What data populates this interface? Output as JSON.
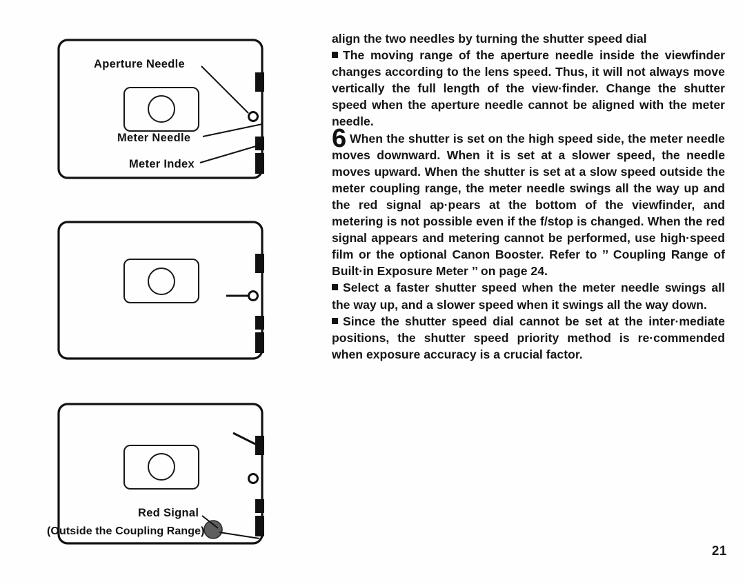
{
  "page": {
    "number": "21",
    "background_color": "#fefefe",
    "ink_color": "#111111"
  },
  "figures": [
    {
      "id": "viewfinder-needles-labeled",
      "labels": {
        "aperture_needle": "Aperture Needle",
        "meter_needle": "Meter Needle",
        "meter_index": "Meter Index"
      }
    },
    {
      "id": "viewfinder-needles-aligned",
      "labels": {}
    },
    {
      "id": "viewfinder-red-signal",
      "labels": {
        "red_signal": "Red Signal",
        "outside_range": "(Outside the Coupling Range)"
      }
    }
  ],
  "body": {
    "lead_line": "align the two needles by turning the shutter speed dial",
    "bullet_1": "The moving range of the aperture needle inside the viewfinder changes according to the lens speed.  Thus, it will not always move vertically the full length of the view·finder.  Change the shutter speed when the aperture needle cannot be aligned with the meter needle.",
    "step_6_numeral": "6",
    "step_6_text": "When the shutter is set on the high speed side, the meter needle moves downward.  When it is set at a slower speed, the needle moves upward.  When the shutter is set at a slow speed outside the meter coupling range, the meter needle swings all the way up and the red signal ap·pears at the bottom of the viewfinder, and metering is not possible even if the f/stop is changed.   When the red signal appears and metering cannot be performed, use high·speed film or the optional Canon Booster. Refer to ’’ Coupling Range of Built·in Exposure Meter ’’ on page 24.",
    "bullet_2": "Select a faster shutter speed when the meter needle swings all the way up, and a slower speed when it swings all the way down.",
    "bullet_3": "Since the shutter speed dial cannot be set at the inter·mediate positions, the shutter speed priority method is re·commended when exposure accuracy is a crucial factor."
  }
}
